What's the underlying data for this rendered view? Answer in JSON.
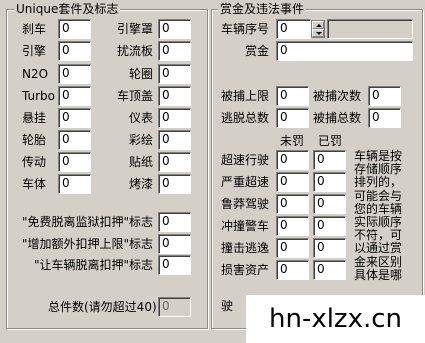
{
  "unique_group": {
    "title": "Unique套件及标志",
    "left_fields": [
      {
        "label": "刹车",
        "value": "0"
      },
      {
        "label": "引擎",
        "value": "0"
      },
      {
        "label": "N2O",
        "value": "0"
      },
      {
        "label": "Turbo",
        "value": "0"
      },
      {
        "label": "悬挂",
        "value": "0"
      },
      {
        "label": "轮胎",
        "value": "0"
      },
      {
        "label": "传动",
        "value": "0"
      },
      {
        "label": "车体",
        "value": "0"
      }
    ],
    "right_fields": [
      {
        "label": "引擎罩",
        "value": "0"
      },
      {
        "label": "扰流板",
        "value": "0"
      },
      {
        "label": "轮圈",
        "value": "0"
      },
      {
        "label": "车顶盖",
        "value": "0"
      },
      {
        "label": "仪表",
        "value": "0"
      },
      {
        "label": "彩绘",
        "value": "0"
      },
      {
        "label": "贴纸",
        "value": "0"
      },
      {
        "label": "烤漆",
        "value": "0"
      }
    ],
    "flags": [
      {
        "label": "\"免费脱离监狱扣押\"标志",
        "value": "0"
      },
      {
        "label": "\"增加额外扣押上限\"标志",
        "value": "0"
      },
      {
        "label": "\"让车辆脱离扣押\"标志",
        "value": "0"
      }
    ],
    "total_label": "总件数(请勿超过40)",
    "total_value": "0"
  },
  "bounty_group": {
    "title": "赏金及违法事件",
    "vehicle_index_label": "车辆序号",
    "vehicle_index_value": "0",
    "bounty_label": "赏金",
    "bounty_value": "0",
    "capture_limit_label": "被捕上限",
    "capture_limit_value": "0",
    "capture_count_label": "被捕次数",
    "capture_count_value": "0",
    "escape_total_label": "逃脱总数",
    "escape_total_value": "0",
    "capture_total_label": "被捕总数",
    "capture_total_value": "0",
    "col_unfined": "未罚",
    "col_fined": "已罚",
    "violations": [
      {
        "label": "超速行驶",
        "unfined": "0",
        "fined": "0"
      },
      {
        "label": "严重超速",
        "unfined": "0",
        "fined": "0"
      },
      {
        "label": "鲁莽驾驶",
        "unfined": "0",
        "fined": "0"
      },
      {
        "label": "冲撞警车",
        "unfined": "0",
        "fined": "0"
      },
      {
        "label": "撞击逃逸",
        "unfined": "0",
        "fined": "0"
      },
      {
        "label": "损害资产",
        "unfined": "0",
        "fined": "0"
      }
    ],
    "partial_label": "驶",
    "note_lines": [
      "车辆是按",
      "存储顺序",
      "排列的，",
      "可能会与",
      "您的车辆",
      "实际顺序",
      "不符，可",
      "以通过赏",
      "金来区别",
      "具体是哪"
    ]
  },
  "watermark": "hn-xlzx.cn"
}
